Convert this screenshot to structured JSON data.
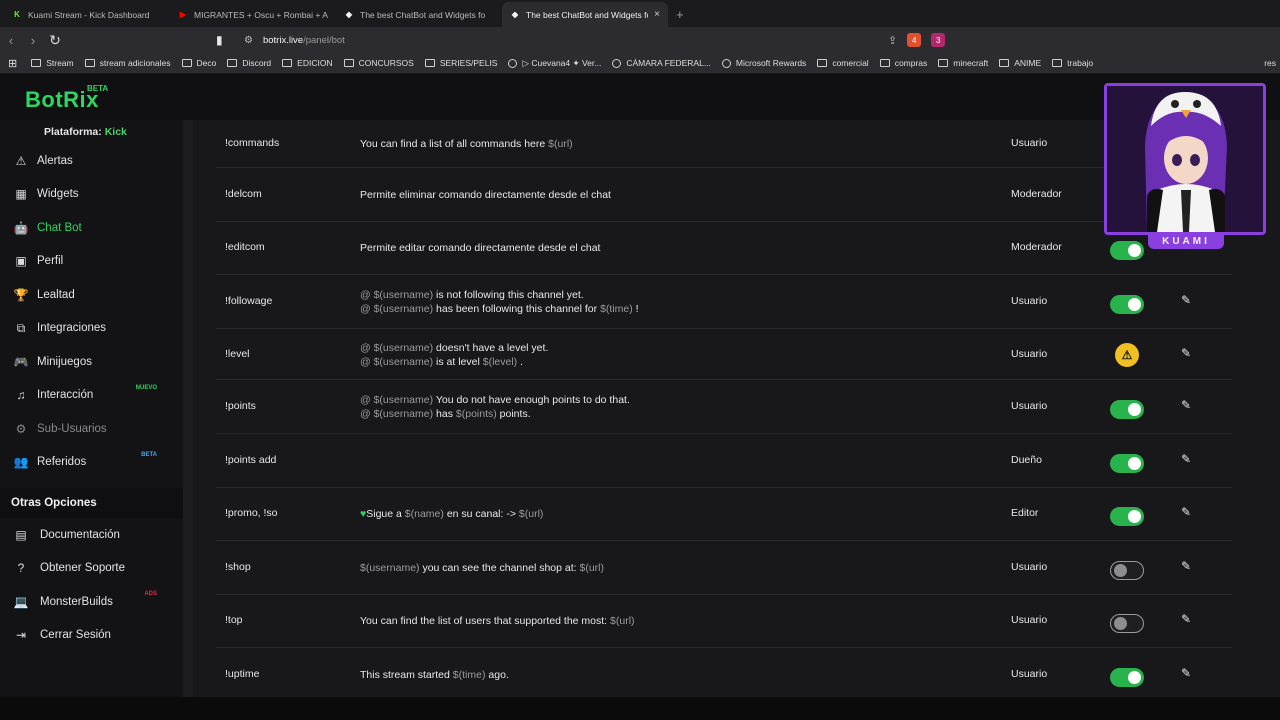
{
  "browser": {
    "tabs": [
      {
        "title": "Kuami Stream - Kick Dashboard",
        "icon": "kick-icon",
        "color": "#53fc18"
      },
      {
        "title": "MIGRANTES + Oscu + Rombai + AG",
        "icon": "youtube-icon",
        "color": "#ff0000"
      },
      {
        "title": "The best ChatBot and Widgets fo",
        "icon": "botrix-icon",
        "color": "#ffffff"
      },
      {
        "title": "The best ChatBot and Widgets fo",
        "icon": "botrix-icon",
        "color": "#ffffff"
      }
    ],
    "new_tab": "+",
    "close_tab": "×",
    "url_host": "botrix.live",
    "url_path": "/panel/bot",
    "brave_badge": "4",
    "rewards_badge": "3",
    "bookmarks": [
      {
        "label": "Stream",
        "type": "folder"
      },
      {
        "label": "stream adicionales",
        "type": "folder"
      },
      {
        "label": "Deco",
        "type": "folder"
      },
      {
        "label": "Discord",
        "type": "folder"
      },
      {
        "label": "EDICION",
        "type": "folder"
      },
      {
        "label": "CONCURSOS",
        "type": "folder"
      },
      {
        "label": "SERIES/PELIS",
        "type": "folder"
      },
      {
        "label": "▷ Cuevana4 ✦ Ver...",
        "type": "site"
      },
      {
        "label": "CÁMARA FEDERAL...",
        "type": "site"
      },
      {
        "label": "Microsoft Rewards",
        "type": "site"
      },
      {
        "label": "comercial",
        "type": "folder"
      },
      {
        "label": "compras",
        "type": "folder"
      },
      {
        "label": "minecraft",
        "type": "folder"
      },
      {
        "label": "ANIME",
        "type": "folder"
      },
      {
        "label": "trabajo",
        "type": "folder"
      }
    ],
    "bookmarks_more": "res"
  },
  "app": {
    "logo": "BotRix",
    "logo_badge": "BETA",
    "platform_label": "Plataforma:",
    "platform_value": "Kick",
    "brand_color": "#2fd562"
  },
  "sidebar": {
    "items": [
      {
        "label": "Alertas",
        "icon": "warning-icon",
        "glyph": "⚠"
      },
      {
        "label": "Widgets",
        "icon": "widgets-grid-icon",
        "glyph": "▦"
      },
      {
        "label": "Chat Bot",
        "icon": "android-bot-icon",
        "glyph": "🤖"
      },
      {
        "label": "Perfil",
        "icon": "id-card-icon",
        "glyph": "▣"
      },
      {
        "label": "Lealtad",
        "icon": "trophy-icon",
        "glyph": "🏆"
      },
      {
        "label": "Integraciones",
        "icon": "integrations-icon",
        "glyph": "⧉"
      },
      {
        "label": "Minijuegos",
        "icon": "gamepad-icon",
        "glyph": "🎮"
      },
      {
        "label": "Interacción",
        "icon": "music-note-icon",
        "glyph": "♫",
        "tag": "NUEVO"
      },
      {
        "label": "Sub-Usuarios",
        "icon": "users-cog-icon",
        "glyph": "⚙"
      },
      {
        "label": "Referidos",
        "icon": "users-icon",
        "glyph": "👥",
        "tag": "BETA"
      }
    ],
    "section_title": "Otras Opciones",
    "other_items": [
      {
        "label": "Documentación",
        "icon": "book-icon",
        "glyph": "▤"
      },
      {
        "label": "Obtener Soporte",
        "icon": "help-circle-icon",
        "glyph": "?"
      },
      {
        "label": "MonsterBuilds",
        "icon": "laptop-icon",
        "glyph": "💻",
        "tag": "ADS"
      },
      {
        "label": "Cerrar Sesión",
        "icon": "logout-icon",
        "glyph": "⇥"
      }
    ]
  },
  "commands": [
    {
      "name": "!commands",
      "role": "Usuario",
      "lines": [
        [
          [
            "t",
            "You can find a list of all commands here"
          ],
          [
            "v",
            "$(url)"
          ]
        ]
      ],
      "status": "hidden"
    },
    {
      "name": "!delcom",
      "role": "Moderador",
      "lines": [
        [
          [
            "t",
            "Permite eliminar comando directamente desde el chat"
          ]
        ]
      ],
      "status": "on"
    },
    {
      "name": "!editcom",
      "role": "Moderador",
      "lines": [
        [
          [
            "t",
            "Permite editar comando directamente desde el chat"
          ]
        ]
      ],
      "status": "on"
    },
    {
      "name": "!followage",
      "role": "Usuario",
      "lines": [
        [
          [
            "v",
            "@ $(username)"
          ],
          [
            "t",
            "is not following this channel yet."
          ]
        ],
        [
          [
            "v",
            "@ $(username)"
          ],
          [
            "t",
            "has been following this channel for"
          ],
          [
            "v",
            "$(time)"
          ],
          [
            "t",
            "!"
          ]
        ]
      ],
      "status": "on"
    },
    {
      "name": "!level",
      "role": "Usuario",
      "lines": [
        [
          [
            "v",
            "@ $(username)"
          ],
          [
            "t",
            "doesn't have a level yet."
          ]
        ],
        [
          [
            "v",
            "@ $(username)"
          ],
          [
            "t",
            "is at level"
          ],
          [
            "v",
            "$(level)"
          ],
          [
            "t",
            "."
          ]
        ]
      ],
      "status": "warning"
    },
    {
      "name": "!points",
      "role": "Usuario",
      "lines": [
        [
          [
            "v",
            "@ $(username)"
          ],
          [
            "t",
            "You do not have enough points to do that."
          ]
        ],
        [
          [
            "v",
            "@ $(username)"
          ],
          [
            "t",
            "has"
          ],
          [
            "v",
            "$(points)"
          ],
          [
            "t",
            "points."
          ]
        ]
      ],
      "status": "on"
    },
    {
      "name": "!points add",
      "role": "Dueño",
      "lines": [],
      "status": "on"
    },
    {
      "name": "!promo, !so",
      "role": "Editor",
      "lines": [
        [
          [
            "h",
            "♥"
          ],
          [
            "t",
            "Sigue a"
          ],
          [
            "v",
            "$(name)"
          ],
          [
            "t",
            "en su canal: ->"
          ],
          [
            "v",
            "$(url)"
          ]
        ]
      ],
      "status": "on"
    },
    {
      "name": "!shop",
      "role": "Usuario",
      "lines": [
        [
          [
            "v",
            "$(username)"
          ],
          [
            "t",
            "you can see the channel shop at:"
          ],
          [
            "v",
            "$(url)"
          ]
        ]
      ],
      "status": "off"
    },
    {
      "name": "!top",
      "role": "Usuario",
      "lines": [
        [
          [
            "t",
            "You can find the list of users that supported the most:"
          ],
          [
            "v",
            "$(url)"
          ]
        ]
      ],
      "status": "off"
    },
    {
      "name": "!uptime",
      "role": "Usuario",
      "lines": [
        [
          [
            "t",
            "This stream started"
          ],
          [
            "v",
            "$(time)"
          ],
          [
            "t",
            "ago."
          ]
        ]
      ],
      "status": "on"
    }
  ],
  "overlay": {
    "name": "KUAMI"
  }
}
